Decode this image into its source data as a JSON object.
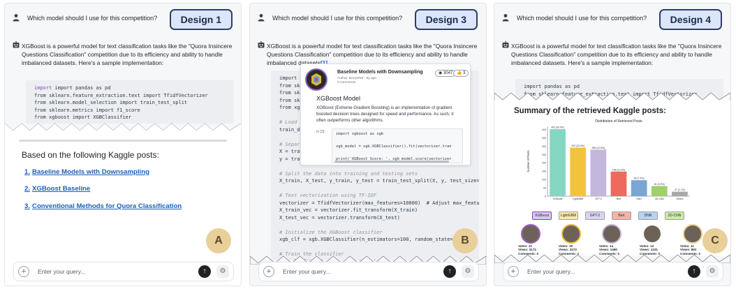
{
  "question": "Which model should I use for this competition?",
  "designs": [
    "Design 1",
    "Design 3",
    "Design 4"
  ],
  "panel_letters": [
    "A",
    "B",
    "C"
  ],
  "answer_text": "XGBoost is a powerful model for text classification tasks like the \"Quora Insincere Questions Classification\" competition due to its efficiency and ability to handle imbalanced datasets. Here's a sample implementation:",
  "answer_text_cited": "XGBoost is a powerful model for text classification tasks like the \"Quora Insincere Questions Classification\" competition due to its efficiency and ability to handle imbalanced datasets",
  "citation": "[1]",
  "code_lines_a": [
    "import pandas as pd",
    "from sklearn.feature_extraction.text import TfidfVectorizer",
    "from sklearn.model_selection import train_test_split",
    "from sklearn.metrics import f1_score",
    "from xgboost import XGBClassifier"
  ],
  "code_lines_b": [
    "import p",
    "from skl",
    "from skl",
    "from skl",
    "from xgb",
    "",
    "# Load d",
    "train_df",
    "",
    "# Separa",
    "X = trai",
    "y = trai",
    "",
    "# Split the data into training and testing sets",
    "X_train, X_test, y_train, y_test = train_test_split(X, y, test_size=0.20, r",
    "",
    "# Text vectorization using TF-IDF",
    "vectorizer = TfidfVectorizer(max_features=10000)  # Adjust max_features as",
    "X_train_vec = vectorizer.fit_transform(X_train)",
    "X_test_vec = vectorizer.transform(X_test)",
    "",
    "# Initialize the XGBoost classifier",
    "xgb_clf = xgb.XGBClassifier(n_estimators=100, random_state=42)",
    "",
    "# Train the classifier",
    "xgb_clf.fit(X_train_vec, y_train)"
  ],
  "code_lines_c": [
    "import pandas as pd",
    "from sklearn.feature_extraction.text import TfidfVectorizer"
  ],
  "kaggle_heading": "Based on the following Kaggle posts:",
  "kaggle_links": [
    {
      "num": "1.",
      "label": "Baseline Models with Downsampling"
    },
    {
      "num": "2.",
      "label": "XGBoost Baseline"
    },
    {
      "num": "3.",
      "label": "Conventional Methods for Quora Classification"
    }
  ],
  "popup": {
    "title": "Baseline Models with Downsampling",
    "author": "Author: BoxyW10 · 5y ago",
    "comments": "0 comments",
    "views": "3047",
    "votes": "3",
    "heading": "XGBoost Model",
    "description": "XGBoost (Extreme Gradient Boosting) is an implementation of gradient boosted decision trees designed for speed and performance. As such, it often outperforms other algorithms.",
    "cell_label": "In [2]:",
    "code": [
      "import xgboost as xgb",
      "",
      "xgb_model = xgb.XGBClassifier().fit(vectorizer.tran",
      "",
      "print('XGBoost Score: ', xgb_model.score(vectorizer"
    ]
  },
  "summary_heading": "Summary of the retrieved Kaggle posts:",
  "chart_data": {
    "type": "bar",
    "title": "Distribution of Retrieved Posts",
    "ylabel": "Number of Posts",
    "xlabel": "",
    "categories": [
      "XGBoost",
      "LightGBM",
      "GPT-2",
      "Bert",
      "DNN",
      "2D-CNN",
      "Others"
    ],
    "values": [
      403,
      292,
      280,
      148,
      96,
      61,
      27
    ],
    "value_labels": [
      "403 (30.0%)",
      "292 (22.4%)",
      "280 (21.5%)",
      "148 (11.3%)",
      "96 (7.4%)",
      "61 (5.3%)",
      "27 (1.7%)"
    ],
    "colors": [
      "#86d6c4",
      "#f2c43c",
      "#c5b6dc",
      "#ee6a5e",
      "#7aa6d4",
      "#9fd06c",
      "#a8a8a8"
    ],
    "ylim": [
      0,
      420
    ],
    "yticks": [
      0,
      50,
      100,
      150,
      200,
      250,
      300,
      350,
      400
    ]
  },
  "legend_items": [
    {
      "label": "XGBoost",
      "color": "#d9c7f0",
      "border": "#8b3fb0"
    },
    {
      "label": "LightGBM",
      "color": "#fbe8a4",
      "border": "#9aa1a9"
    },
    {
      "label": "GPT-2",
      "color": "#dcd3ec",
      "border": "#9aa1a9"
    },
    {
      "label": "Bert",
      "color": "#f6b3a8",
      "border": "#9aa1a9"
    },
    {
      "label": "DNN",
      "color": "#b9d3ee",
      "border": "#9aa1a9"
    },
    {
      "label": "2D-CNN",
      "color": "#cdeaa6",
      "border": "#9aa1a9"
    }
  ],
  "authors": [
    {
      "stats": [
        "Votes: 21",
        "Views: 3172",
        "Comments: 0"
      ],
      "ring": "#9b5fc4"
    },
    {
      "stats": [
        "Votes: 19",
        "Views: 3272",
        "Comments: 2"
      ],
      "ring": "#e6b93b"
    },
    {
      "stats": [
        "Votes: 14",
        "Views: 1480",
        "Comments: 0"
      ],
      "ring": "#c4b6dc"
    },
    {
      "stats": [
        "Votes: 13",
        "Views: 1231",
        "Comments: 0"
      ],
      "ring": "#ffffff"
    },
    {
      "stats": [
        "Votes: 11",
        "Views: 892",
        "Comments: 0"
      ],
      "ring": "#e6d290"
    }
  ],
  "query_placeholder": "Enter your query...",
  "icons": {
    "user": "person-icon",
    "bot": "robot-icon",
    "plus": "+",
    "send": "↑",
    "gear": "⚙"
  }
}
